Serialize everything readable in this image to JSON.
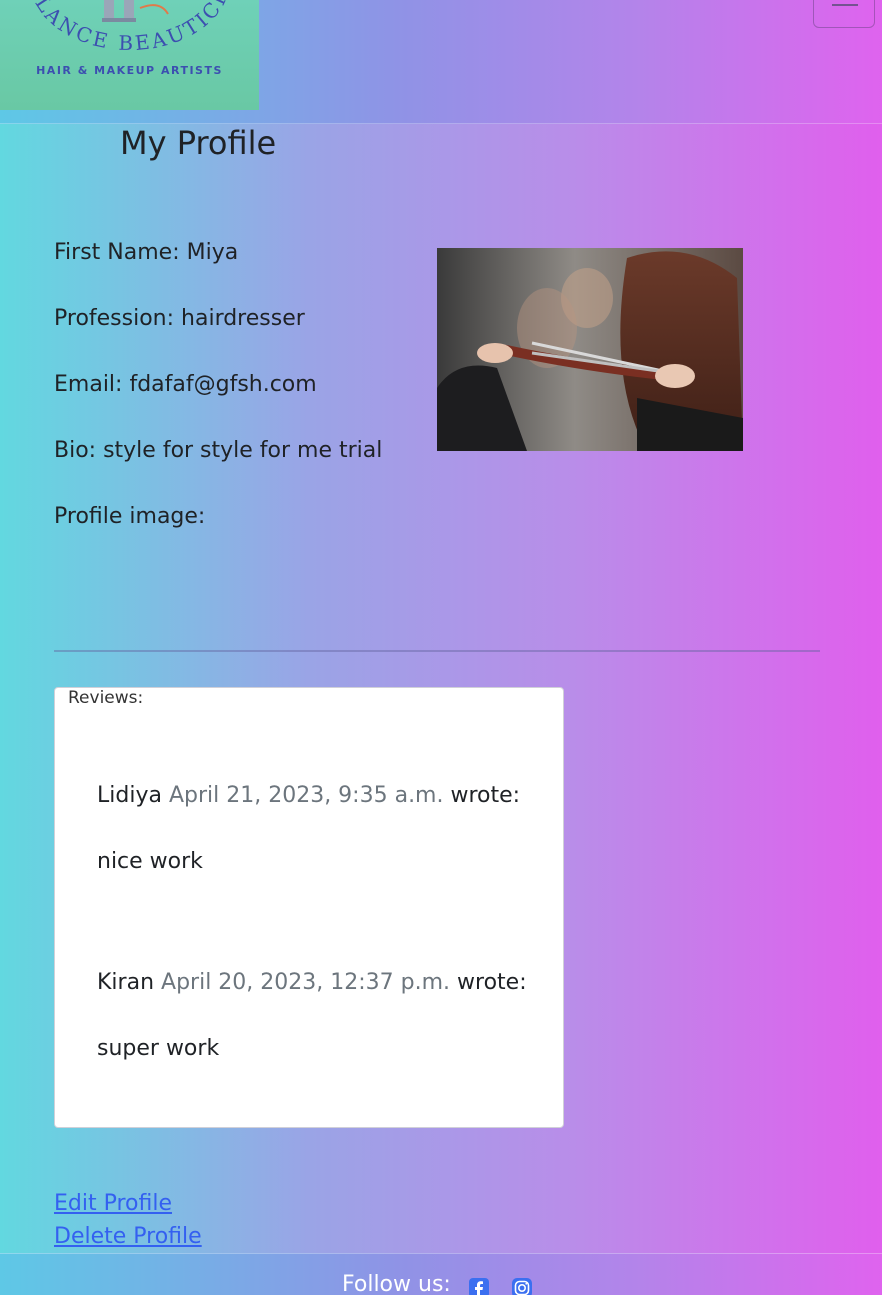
{
  "brand": {
    "logo_arc_text": "ELANCE BEAUTICIA",
    "logo_subtitle": "HAIR & MAKEUP ARTISTS",
    "logo_icon": "scissors-logo-icon"
  },
  "nav": {
    "toggler_icon": "hamburger-menu-icon"
  },
  "profile": {
    "title": "My Profile",
    "first_name": "First Name: Miya",
    "profession": "Profession: hairdresser",
    "email": "Email: fdafaf@gfsh.com",
    "bio": "Bio: style for style for me trial",
    "image_label": "Profile image:"
  },
  "reviews": {
    "heading": "Reviews:",
    "items": [
      {
        "author": "Lidiya",
        "date": "April 21, 2023, 9:35 a.m.",
        "wrote": "wrote:",
        "text": "nice work"
      },
      {
        "author": "Kiran",
        "date": "April 20, 2023, 12:37 p.m.",
        "wrote": "wrote:",
        "text": "super work"
      }
    ]
  },
  "actions": {
    "edit": "Edit Profile",
    "delete": "Delete Profile"
  },
  "footer": {
    "follow_text": "Follow us:",
    "icons": [
      "facebook-icon",
      "instagram-icon"
    ]
  },
  "colors": {
    "link": "#3460f0",
    "social_icon": "#3b6ff0",
    "gradient_start": "#62d8e0",
    "gradient_end": "#e05fed"
  }
}
